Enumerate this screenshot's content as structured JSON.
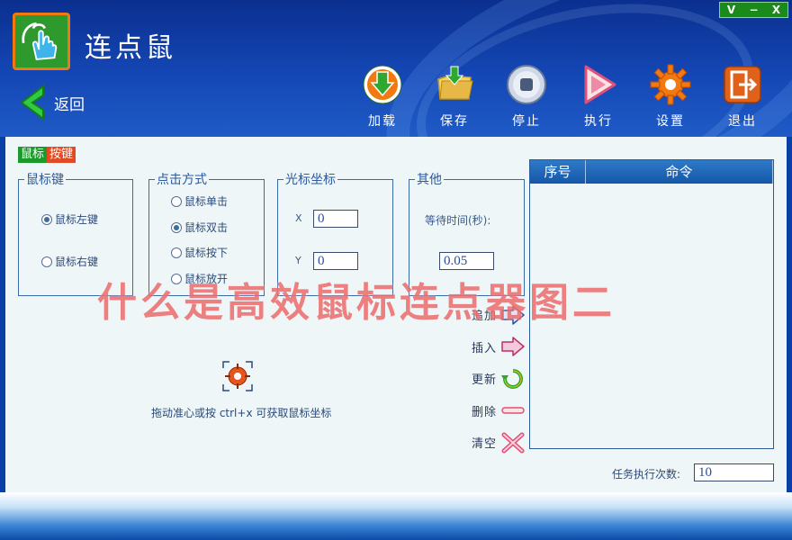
{
  "window_controls": {
    "restore": "V",
    "minimize": "−",
    "close": "X"
  },
  "app": {
    "title": "连点鼠"
  },
  "nav": {
    "back_label": "返回"
  },
  "toolbar": [
    {
      "label": "加载",
      "icon": "download-icon"
    },
    {
      "label": "保存",
      "icon": "folder-save-icon"
    },
    {
      "label": "停止",
      "icon": "stop-icon"
    },
    {
      "label": "执行",
      "icon": "play-icon"
    },
    {
      "label": "设置",
      "icon": "gear-icon"
    },
    {
      "label": "退出",
      "icon": "exit-icon"
    }
  ],
  "section_tag": {
    "part1": "鼠标",
    "part2": "按键"
  },
  "mouse_key": {
    "legend": "鼠标键",
    "left": "鼠标左键",
    "right": "鼠标右键",
    "selected": "left"
  },
  "click_mode": {
    "legend": "点击方式",
    "options": [
      "鼠标单击",
      "鼠标双击",
      "鼠标按下",
      "鼠标放开"
    ],
    "selected_index": 1
  },
  "cursor_coords": {
    "legend": "光标坐标",
    "x_label": "X",
    "x_value": "0",
    "y_label": "Y",
    "y_value": "0"
  },
  "other": {
    "legend": "其他",
    "wait_label": "等待时间(秒):",
    "wait_value": "0.05"
  },
  "crosshair_hint": "拖动准心或按 ctrl+x 可获取鼠标坐标",
  "command_list": {
    "col_index": "序号",
    "col_command": "命令",
    "rows": []
  },
  "list_ops": [
    {
      "label": "追加",
      "icon": "arrow-right-icon"
    },
    {
      "label": "插入",
      "icon": "arrow-right-pink-icon"
    },
    {
      "label": "更新",
      "icon": "refresh-icon"
    },
    {
      "label": "删除",
      "icon": "minus-icon"
    },
    {
      "label": "清空",
      "icon": "clear-x-icon"
    }
  ],
  "task_count": {
    "label": "任务执行次数:",
    "value": "10"
  },
  "watermark": "什么是高效鼠标连点器图二",
  "colors": {
    "header": "#0b3fa8",
    "content_bg": "#eef6f8",
    "accent_green": "#1b9a2a",
    "accent_orange": "#e14a23",
    "list_header": "#1557a8"
  }
}
